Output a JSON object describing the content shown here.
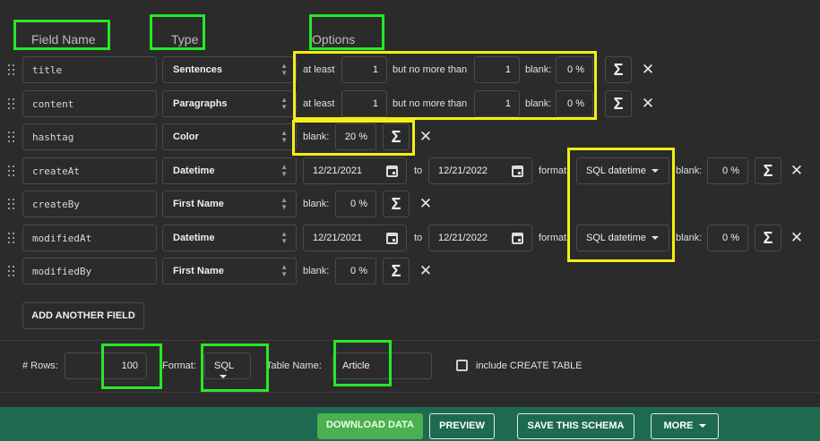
{
  "headers": {
    "field_name": "Field Name",
    "type": "Type",
    "options": "Options"
  },
  "rows": [
    {
      "name": "title",
      "type": "Sentences",
      "at_least": "at least",
      "min": "1",
      "but_no_more": "but no more than",
      "max": "1",
      "blank_label": "blank:",
      "blank": "0 %"
    },
    {
      "name": "content",
      "type": "Paragraphs",
      "at_least": "at least",
      "min": "1",
      "but_no_more": "but no more than",
      "max": "1",
      "blank_label": "blank:",
      "blank": "0 %"
    },
    {
      "name": "hashtag",
      "type": "Color",
      "blank_label": "blank:",
      "blank": "20 %"
    },
    {
      "name": "createAt",
      "type": "Datetime",
      "from": "12/21/2021",
      "to_label": "to",
      "to": "12/21/2022",
      "format_label": "format:",
      "format": "SQL datetime",
      "blank_label": "blank:",
      "blank": "0 %"
    },
    {
      "name": "createBy",
      "type": "First Name",
      "blank_label": "blank:",
      "blank": "0 %"
    },
    {
      "name": "modifiedAt",
      "type": "Datetime",
      "from": "12/21/2021",
      "to_label": "to",
      "to": "12/21/2022",
      "format_label": "format:",
      "format": "SQL datetime",
      "blank_label": "blank:",
      "blank": "0 %"
    },
    {
      "name": "modifiedBy",
      "type": "First Name",
      "blank_label": "blank:",
      "blank": "0 %"
    }
  ],
  "icons": {
    "sigma": "Σ",
    "remove": "✕",
    "type_select": "⌃⌄"
  },
  "add_field_label": "ADD ANOTHER FIELD",
  "settings": {
    "rows_label": "# Rows:",
    "rows_value": "100",
    "format_label": "Format:",
    "format_value": "SQL",
    "table_name_label": "Table Name:",
    "table_name_value": "Article",
    "include_create_label": "include CREATE TABLE"
  },
  "actions": {
    "download": "DOWNLOAD DATA",
    "preview": "PREVIEW",
    "save_schema": "SAVE THIS SCHEMA",
    "more": "MORE"
  },
  "colors": {
    "background": "#2b2b2b",
    "bottom_bar": "#1e6a4f",
    "download_button": "#4caf50",
    "highlight_green": "#27e827",
    "highlight_yellow": "#f2ef14"
  }
}
